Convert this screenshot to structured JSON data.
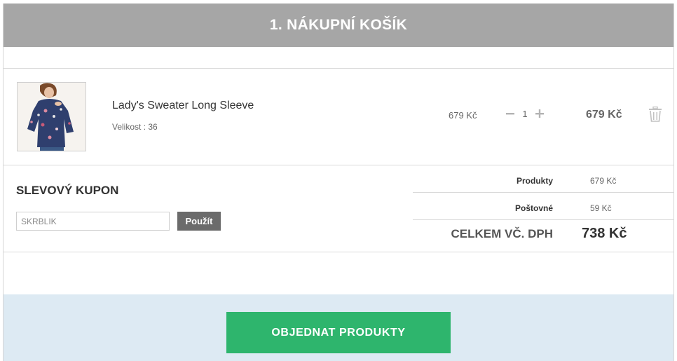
{
  "header": {
    "title": "1. NÁKUPNÍ KOŠÍK"
  },
  "cart": {
    "items": [
      {
        "name": "Lady's Sweater Long Sleeve",
        "size_label": "Velikost : 36",
        "unit_price": "679 Kč",
        "quantity": "1",
        "line_total": "679 Kč",
        "thumbnail_icon": "sweater-product-photo",
        "remove_icon": "trash-icon"
      }
    ]
  },
  "coupon": {
    "title": "SLEVOVÝ KUPON",
    "input_value": "",
    "input_placeholder": "SKRBLIK",
    "apply_label": "Použít"
  },
  "totals": {
    "products_label": "Produkty",
    "products_value": "679 Kč",
    "shipping_label": "Poštovné",
    "shipping_value": "59 Kč",
    "total_label": "CELKEM VČ. DPH",
    "total_value": "738 Kč"
  },
  "order": {
    "button_label": "OBJEDNAT PRODUKTY"
  },
  "colors": {
    "header_bg": "#a6a6a6",
    "order_button": "#2eb56d",
    "order_band": "#ddeaf3",
    "coupon_button": "#6b6b6b"
  }
}
